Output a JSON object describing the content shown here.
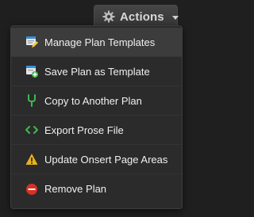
{
  "toolbar": {
    "actions_label": "Actions",
    "gear_icon": "gear-icon",
    "caret_icon": "chevron-down-icon"
  },
  "menu": {
    "items": [
      {
        "label": "Manage Plan Templates",
        "icon": "template-edit-icon"
      },
      {
        "label": "Save Plan as Template",
        "icon": "template-add-icon"
      },
      {
        "label": "Copy to Another Plan",
        "icon": "fork-icon"
      },
      {
        "label": "Export Prose File",
        "icon": "code-icon"
      },
      {
        "label": "Update Onsert Page Areas",
        "icon": "warning-icon"
      },
      {
        "label": "Remove Plan",
        "icon": "remove-icon"
      }
    ]
  },
  "colors": {
    "background": "#1f1f1f",
    "menu_background": "#2b2b2b",
    "active_item": "#3c3c3c",
    "green_accent": "#3fb950",
    "warning_yellow": "#e8b21e",
    "danger_red": "#d93025",
    "template_blue": "#3b8ede"
  }
}
